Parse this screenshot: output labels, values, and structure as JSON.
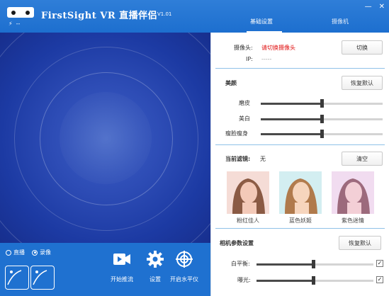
{
  "app": {
    "title": "FirstSight VR 直播伴侣",
    "version": "V1.01",
    "status_icon": "lightning-icon",
    "status_text": "--"
  },
  "tabs": [
    {
      "label": "基础设置",
      "active": true
    },
    {
      "label": "摄像机",
      "active": false
    }
  ],
  "camera": {
    "label": "摄像头:",
    "value": "请切换摄像头",
    "switch_button": "切换",
    "ip_label": "IP:",
    "ip_value": "-----"
  },
  "beauty": {
    "title": "美颜",
    "reset_button": "恢复默认",
    "sliders": [
      {
        "label": "磨皮",
        "value": 0.5
      },
      {
        "label": "美白",
        "value": 0.5
      },
      {
        "label": "瘦脸瘦身",
        "value": 0.5
      }
    ]
  },
  "filter": {
    "label": "当前滤镜:",
    "current": "无",
    "clear_button": "清空",
    "options": [
      {
        "label": "粉红佳人",
        "tint": "#f2d6cf"
      },
      {
        "label": "蓝色妖姬",
        "tint": "#d6eef0"
      },
      {
        "label": "紫色迷情",
        "tint": "#efd8ef"
      }
    ]
  },
  "camera_params": {
    "title": "相机参数设置",
    "reset_button": "恢复默认",
    "sliders": [
      {
        "label": "白平衡:",
        "value": 0.48,
        "auto": true
      },
      {
        "label": "曝光:",
        "value": 0.48,
        "auto": true
      }
    ]
  },
  "record_mode": {
    "options": [
      {
        "label": "直播",
        "selected": false
      },
      {
        "label": "录像",
        "selected": true
      }
    ]
  },
  "actions": [
    {
      "label": "开始推流",
      "icon": "video-camera-icon"
    },
    {
      "label": "设置",
      "icon": "gear-icon"
    },
    {
      "label": "开启水平仪",
      "icon": "crosshair-icon"
    }
  ],
  "colors": {
    "titlebar": "#1f71d0",
    "preview": "#2540a8",
    "accent_line": "#8fc1e8",
    "warning_text": "#e01010"
  }
}
